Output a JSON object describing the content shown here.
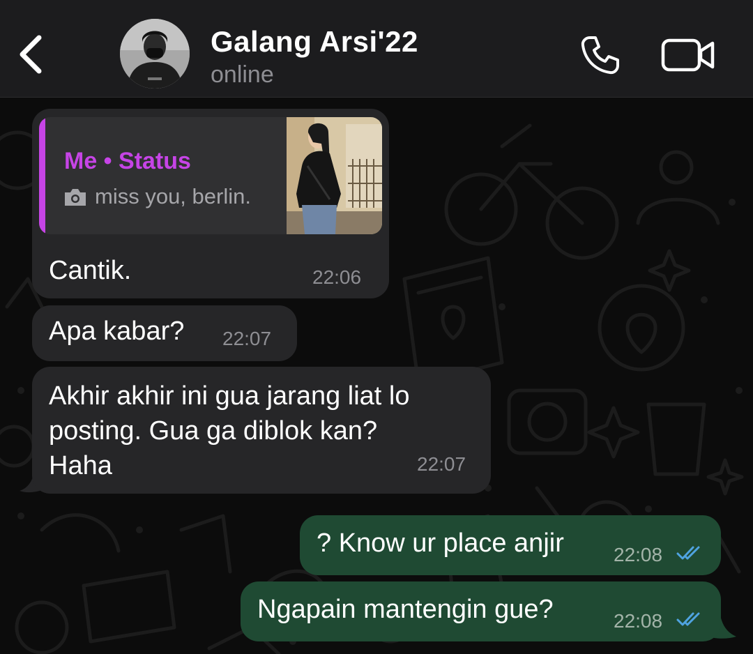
{
  "header": {
    "contact_name": "Galang Arsi'22",
    "contact_status": "online",
    "icons": {
      "back": "chevron-left-icon",
      "call": "phone-icon",
      "video": "video-camera-icon"
    }
  },
  "messages": [
    {
      "direction": "incoming",
      "reply": {
        "title": "Me • Status",
        "caption": "miss you, berlin.",
        "icon": "camera-icon"
      },
      "text": "Cantik.",
      "time": "22:06"
    },
    {
      "direction": "incoming",
      "text": "Apa kabar?",
      "time": "22:07"
    },
    {
      "direction": "incoming",
      "lines": [
        "Akhir akhir ini gua jarang liat lo",
        "posting. Gua ga diblok kan?",
        "Haha"
      ],
      "time": "22:07"
    },
    {
      "direction": "outgoing",
      "text": "? Know ur place anjir",
      "time": "22:08",
      "status": "read"
    },
    {
      "direction": "outgoing",
      "text": "Ngapain mantengin gue?",
      "time": "22:08",
      "status": "read"
    }
  ],
  "colors": {
    "header_bg": "#1c1c1e",
    "incoming_bubble": "#262628",
    "outgoing_bubble": "#1f4a33",
    "reply_accent": "#c644e6",
    "read_tick": "#4fa3e0",
    "timestamp": "#8e8e93"
  }
}
